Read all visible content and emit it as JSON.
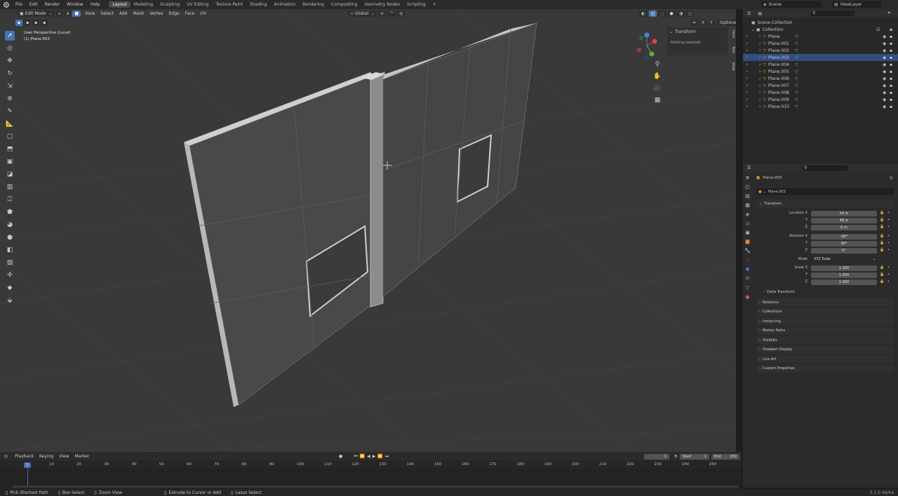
{
  "topbar": {
    "menus": [
      "File",
      "Edit",
      "Render",
      "Window",
      "Help"
    ],
    "workspaces": [
      "Layout",
      "Modeling",
      "Sculpting",
      "UV Editing",
      "Texture Paint",
      "Shading",
      "Animation",
      "Rendering",
      "Compositing",
      "Geometry Nodes",
      "Scripting"
    ],
    "active_workspace": "Layout",
    "add_tab": "+",
    "scene": "Scene",
    "view_layer": "ViewLayer"
  },
  "viewport_header": {
    "mode": "Edit Mode",
    "menus": [
      "View",
      "Select",
      "Add",
      "Mesh",
      "Vertex",
      "Edge",
      "Face",
      "UV"
    ],
    "orientation": "Global",
    "axes": [
      "X",
      "Y",
      "Z"
    ],
    "options": "Options"
  },
  "viewport": {
    "perspective": "User Perspective (Local)",
    "object": "(1) Plane.003"
  },
  "sidebar": {
    "tabs": [
      "Item",
      "Tool",
      "View"
    ],
    "section": "Transform",
    "message": "Nothing selected"
  },
  "outliner": {
    "root": "Scene Collection",
    "collection": "Collection",
    "items": [
      "Plane",
      "Plane.001",
      "Plane.002",
      "Plane.003",
      "Plane.004",
      "Plane.005",
      "Plane.006",
      "Plane.007",
      "Plane.008",
      "Plane.009",
      "Plane.010"
    ],
    "selected_index": 3
  },
  "properties": {
    "object_name": "Plane.003",
    "datablock": "Plane.003",
    "transform_title": "Transform",
    "location": {
      "label_x": "Location X",
      "label_y": "Y",
      "label_z": "Z",
      "x": "54 m",
      "y": "48 m",
      "z": "6 m"
    },
    "rotation": {
      "label_x": "Rotation X",
      "label_y": "Y",
      "label_z": "Z",
      "x": "-90°",
      "y": "90°",
      "z": "0°"
    },
    "mode_label": "Mode",
    "mode_value": "XYZ Euler",
    "scale": {
      "label_x": "Scale X",
      "label_y": "Y",
      "label_z": "Z",
      "x": "1.000",
      "y": "1.000",
      "z": "1.000"
    },
    "delta_transform": "Delta Transform",
    "panels": [
      "Relations",
      "Collections",
      "Instancing",
      "Motion Paths",
      "Visibility",
      "Viewport Display",
      "Line Art",
      "Custom Properties"
    ]
  },
  "timeline": {
    "menus": [
      "Playback",
      "Keying",
      "View",
      "Marker"
    ],
    "current_frame": "1",
    "start_label": "Start",
    "start": "1",
    "end_label": "End",
    "end": "250",
    "ticks": [
      "10",
      "20",
      "30",
      "40",
      "50",
      "60",
      "70",
      "80",
      "90",
      "100",
      "110",
      "120",
      "130",
      "140",
      "150",
      "160",
      "170",
      "180",
      "190",
      "200",
      "210",
      "220",
      "230",
      "240",
      "250"
    ],
    "playhead": "1"
  },
  "statusbar": {
    "items": [
      "Pick Shortest Path",
      "Box Select",
      "Zoom View",
      "Extrude to Cursor or Add",
      "Lasso Select"
    ],
    "version": "3.1.0 Alpha"
  },
  "colors": {
    "accent": "#4772b3",
    "selection": "#334d80",
    "viewport_bg": "#393939",
    "mesh_face": "#4a4848",
    "mesh_edge": "#9a9a9a",
    "mesh_outline": "#d6d6d6"
  }
}
